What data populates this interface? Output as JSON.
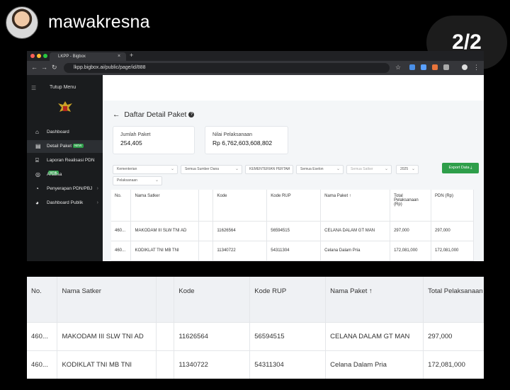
{
  "post": {
    "username": "mawakresna",
    "page_indicator": "2/2"
  },
  "browser": {
    "tab_title": "LKPP - Bigbox",
    "tab_close": "×",
    "new_tab": "+",
    "url": "lkpp.bigbox.ai/public/page/id/888"
  },
  "sidebar": {
    "toggle_label": "Tutup Menu",
    "items": [
      {
        "label": "Dashboard",
        "icon": "home-icon"
      },
      {
        "label": "Detail Paket",
        "badge": "NEW",
        "icon": "document-icon"
      },
      {
        "label": "Laporan Realisasi PDN",
        "badge": "NEW",
        "icon": "bank-icon"
      },
      {
        "label": "Analisa",
        "icon": "target-icon"
      },
      {
        "label": "Penyerapan PDN/PBJ",
        "icon": "pie-icon"
      },
      {
        "label": "Dashboard Publik",
        "icon": "chart-icon"
      }
    ]
  },
  "main": {
    "back_arrow": "←",
    "title": "Daftar Detail Paket",
    "help_icon": "?",
    "cards": [
      {
        "label": "Jumlah Paket",
        "value": "254,405"
      },
      {
        "label": "Nilai Pelaksanaan",
        "value": "Rp 6,762,603,608,802"
      }
    ],
    "filters": [
      "Kementerian",
      "Semua Sumber Dana",
      "KEMENTERIAN PERTAH",
      "Semua Eselon",
      "Semua Satker",
      "2025",
      "Pelaksanaan"
    ],
    "export_label": "Export Data ⤓"
  },
  "table_small": {
    "columns": [
      "No.",
      "Nama Satker",
      "",
      "Kode",
      "Kode RUP",
      "Nama Paket ↑",
      "Total Pelaksanaan (Rp)",
      "PDN (Rp)"
    ],
    "rows": [
      [
        "460...",
        "MAKODAM III SLW TNI AD",
        "",
        "11626564",
        "56594515",
        "CELANA DALAM GT MAN",
        "297,000",
        "297,000"
      ],
      [
        "460...",
        "KODIKLAT TNI MB TNI",
        "",
        "11340722",
        "54311304",
        "Celana Dalam Pria",
        "172,081,000",
        "172,081,000"
      ]
    ]
  },
  "table_zoom": {
    "columns": [
      "No.",
      "Nama Satker",
      "",
      "Kode",
      "Kode RUP",
      "Nama Paket ↑",
      "Total Pelaksanaan (Rp)"
    ],
    "rows": [
      [
        "460...",
        "MAKODAM III SLW TNI AD",
        "",
        "11626564",
        "56594515",
        "CELANA DALAM GT MAN",
        "297,000"
      ],
      [
        "460...",
        "KODIKLAT TNI MB TNI",
        "",
        "11340722",
        "54311304",
        "Celana Dalam Pria",
        "172,081,000"
      ]
    ]
  }
}
